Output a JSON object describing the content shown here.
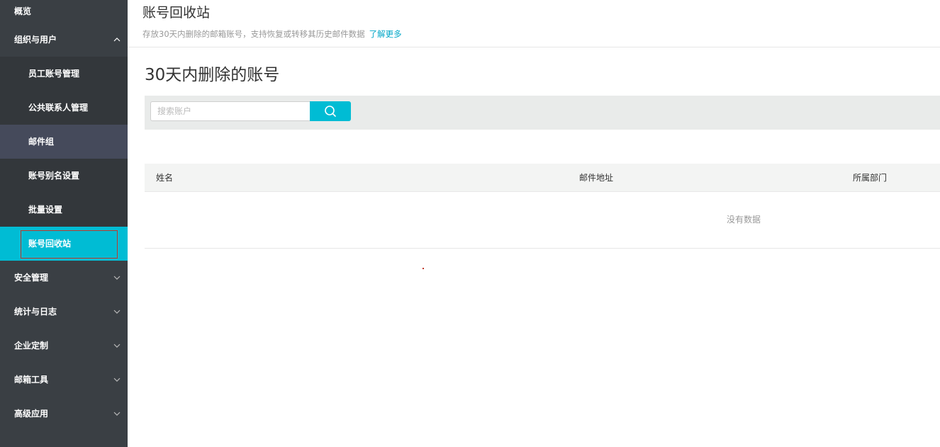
{
  "sidebar": {
    "items": [
      {
        "label": "概览"
      },
      {
        "label": "组织与用户"
      },
      {
        "label": "员工账号管理"
      },
      {
        "label": "公共联系人管理"
      },
      {
        "label": "邮件组"
      },
      {
        "label": "账号别名设置"
      },
      {
        "label": "批量设置"
      },
      {
        "label": "账号回收站"
      },
      {
        "label": "安全管理"
      },
      {
        "label": "统计与日志"
      },
      {
        "label": "企业定制"
      },
      {
        "label": "邮箱工具"
      },
      {
        "label": "高级应用"
      }
    ]
  },
  "header": {
    "title": "账号回收站",
    "description": "存放30天内删除的邮箱账号，支持恢复或转移其历史邮件数据",
    "learn_more": "了解更多"
  },
  "main": {
    "section_title": "30天内删除的账号",
    "search": {
      "placeholder": "搜索账户",
      "value": ""
    },
    "table": {
      "columns": [
        "姓名",
        "邮件地址",
        "所属部门"
      ],
      "empty_text": "没有数据"
    }
  },
  "colors": {
    "sidebar_bg": "#3a3f44",
    "active": "#00bcd4",
    "accent_link": "#00a6c7"
  }
}
